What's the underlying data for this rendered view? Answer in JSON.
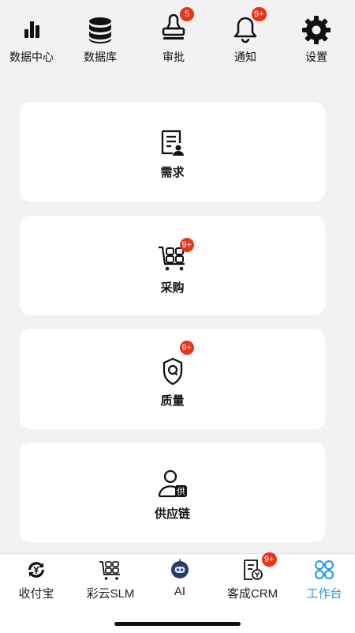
{
  "top_nav": {
    "items": [
      {
        "label": "数据中心",
        "icon": "bar-chart-icon"
      },
      {
        "label": "数据库",
        "icon": "database-icon"
      },
      {
        "label": "审批",
        "icon": "stamp-icon",
        "badge": "5"
      },
      {
        "label": "通知",
        "icon": "bell-icon",
        "badge": "9+"
      },
      {
        "label": "设置",
        "icon": "gear-icon"
      }
    ]
  },
  "cards": [
    {
      "label": "需求",
      "icon": "requirement-doc-icon"
    },
    {
      "label": "采购",
      "icon": "purchase-cart-icon",
      "badge": "9+"
    },
    {
      "label": "质量",
      "icon": "quality-shield-icon",
      "badge": "9+"
    },
    {
      "label": "供应链",
      "icon": "supplier-person-icon",
      "icon_text": "供"
    }
  ],
  "bottom_tabs": {
    "items": [
      {
        "label": "收付宝",
        "icon": "payment-exchange-icon"
      },
      {
        "label": "彩云SLM",
        "icon": "slm-cart-icon"
      },
      {
        "label": "AI",
        "icon": "ai-robot-icon"
      },
      {
        "label": "客成CRM",
        "icon": "crm-doc-icon",
        "badge": "9+"
      },
      {
        "label": "工作台",
        "icon": "workbench-grid-icon",
        "active": true
      }
    ]
  },
  "colors": {
    "badge": "#e8341a",
    "active_tab": "#1a9be6",
    "background": "#f2f2f2"
  }
}
